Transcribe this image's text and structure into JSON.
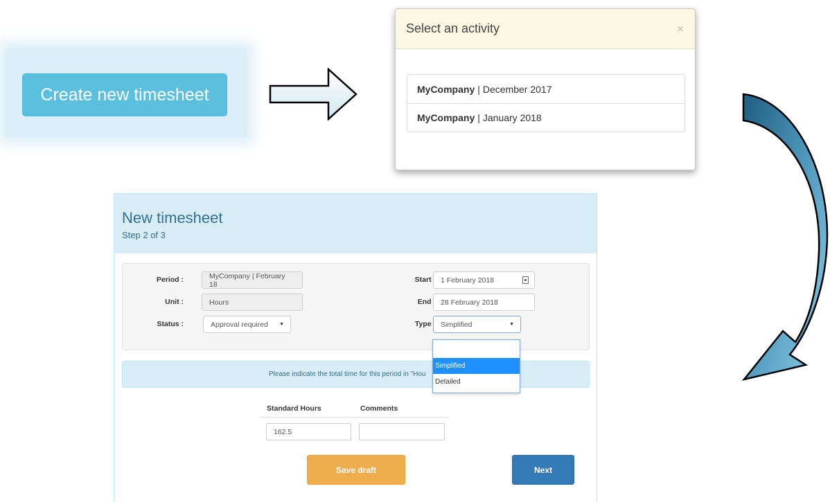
{
  "create": {
    "button_label": "Create new timesheet"
  },
  "modal": {
    "title": "Select an activity",
    "close_glyph": "×",
    "activities": [
      {
        "company": "MyCompany",
        "separator": "|",
        "period": "December 2017"
      },
      {
        "company": "MyCompany",
        "separator": "|",
        "period": "January 2018"
      }
    ]
  },
  "form": {
    "title": "New timesheet",
    "step": "Step 2 of 3",
    "period_label": "Period :",
    "period_value": "MyCompany | February 18",
    "unit_label": "Unit :",
    "unit_value": "Hours",
    "status_label": "Status :",
    "status_value": "Approval required",
    "start_label": "Start :",
    "start_value": "1 February 2018",
    "end_label": "End :",
    "end_value": "28 February 2018",
    "type_label": "Type :",
    "type_value": "Simplified",
    "info_text": "Please indicate the total time for this period in \"Hou",
    "col_hours": "Standard Hours",
    "col_comments": "Comments",
    "hours_value": "162.5",
    "comments_value": "",
    "save_label": "Save draft",
    "next_label": "Next"
  },
  "type_dropdown": {
    "options": [
      "",
      "Simplified",
      "Detailed"
    ],
    "selected": "Simplified"
  },
  "icons": {
    "caret": "caret-down-icon",
    "calendar": "calendar-icon",
    "arrow_right": "arrow-right-icon",
    "arrow_curve": "curved-arrow-icon"
  },
  "colors": {
    "info_blue": "#5bc0de",
    "primary": "#337ab7",
    "warning": "#f0ad4e",
    "panel_header": "#d9edf7",
    "modal_header": "#fcf8e3",
    "dropdown_selected": "#1e90ff"
  }
}
